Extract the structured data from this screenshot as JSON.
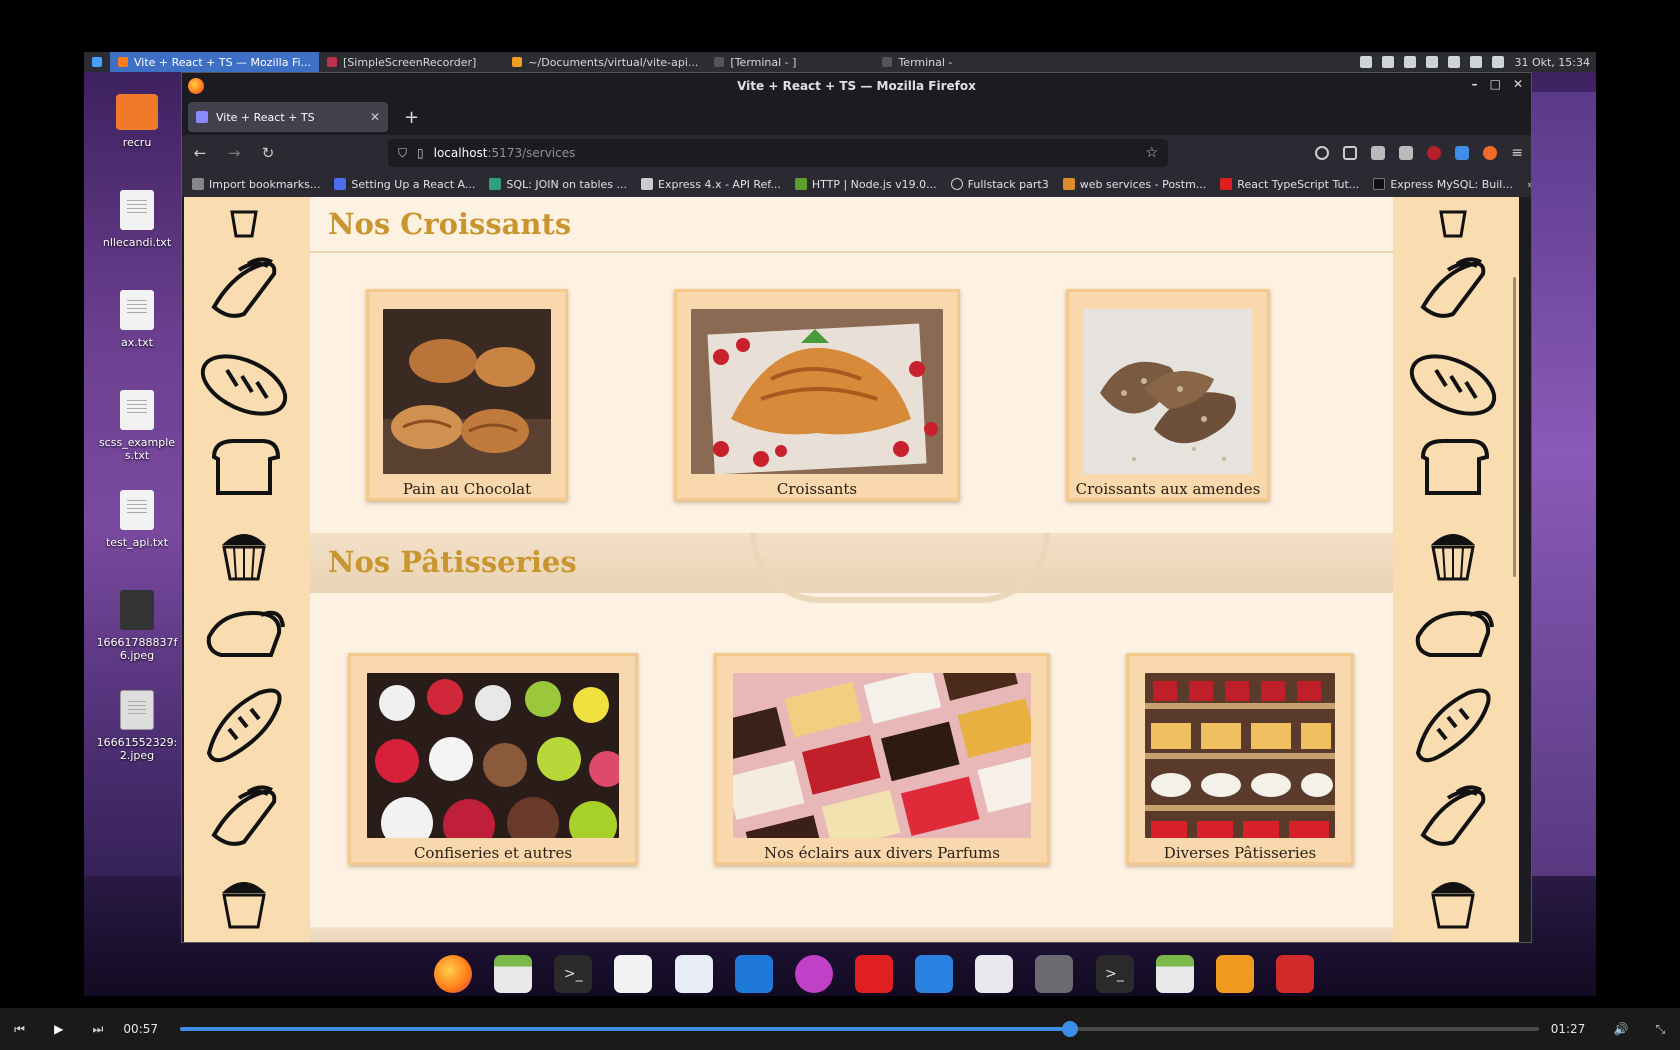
{
  "system_panel": {
    "tasks": [
      {
        "label": "Vite + React + TS — Mozilla Fi...",
        "active": true,
        "color": "#ff7a18"
      },
      {
        "label": "[SimpleScreenRecorder]",
        "active": false,
        "color": "#c0304a"
      },
      {
        "label": "~/Documents/virtual/vite-api...",
        "active": false,
        "color": "#f0a020"
      },
      {
        "label": "[Terminal - ]",
        "active": false,
        "color": "#555555"
      },
      {
        "label": "Terminal -",
        "active": false,
        "color": "#555555"
      }
    ],
    "clock": "31 Okt, 15:34"
  },
  "desktop": {
    "icons": [
      {
        "label": "recru",
        "kind": "folder"
      },
      {
        "label": "nllecandi.txt",
        "kind": "text"
      },
      {
        "label": "ax.txt",
        "kind": "text"
      },
      {
        "label": "scss_examples.txt",
        "kind": "text"
      },
      {
        "label": "test_api.txt",
        "kind": "text"
      },
      {
        "label": "16661788837f6.jpeg",
        "kind": "dark"
      },
      {
        "label": "16661552329:2.jpeg",
        "kind": "img"
      }
    ]
  },
  "firefox": {
    "window_title": "Vite + React + TS — Mozilla Firefox",
    "tab_title": "Vite + React + TS",
    "url_host": "localhost",
    "url_path": ":5173/services",
    "bookmarks": [
      "Import bookmarks...",
      "Setting Up a React A...",
      "SQL: JOIN on tables ...",
      "Express 4.x - API Ref...",
      "HTTP | Node.js v19.0...",
      "Fullstack part3",
      "web services - Postm...",
      "React TypeScript Tut...",
      "Express MySQL: Buil..."
    ],
    "more_bookmarks": "»"
  },
  "page": {
    "sections": [
      {
        "title": "Nos Croissants",
        "items": [
          "Pain au Chocolat",
          "Croissants",
          "Croissants aux amendes"
        ]
      },
      {
        "title": "Nos Pâtisseries",
        "items": [
          "Confiseries et autres",
          "Nos éclairs aux divers Parfums",
          "Diverses Pâtisseries"
        ]
      }
    ],
    "colors": {
      "heading": "#c9952e",
      "card_bg": "#f8d8ac",
      "side_bg": "#f9dcb0"
    }
  },
  "player": {
    "current_time": "00:57",
    "total_time": "01:27",
    "progress": 0.655
  }
}
